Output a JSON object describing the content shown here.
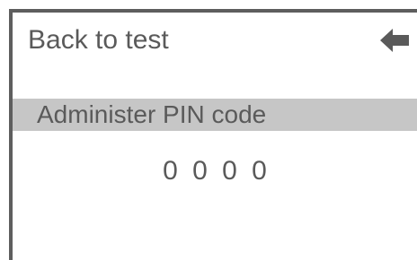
{
  "back": {
    "label": "Back to test",
    "icon": "back-arrow-icon"
  },
  "section": {
    "title": "Administer PIN code"
  },
  "pin": {
    "value": "0 0 0 0"
  },
  "colors": {
    "text": "#5a5a5a",
    "frame": "#5e5e5e",
    "header_bg": "#c6c6c6",
    "background": "#ffffff"
  }
}
